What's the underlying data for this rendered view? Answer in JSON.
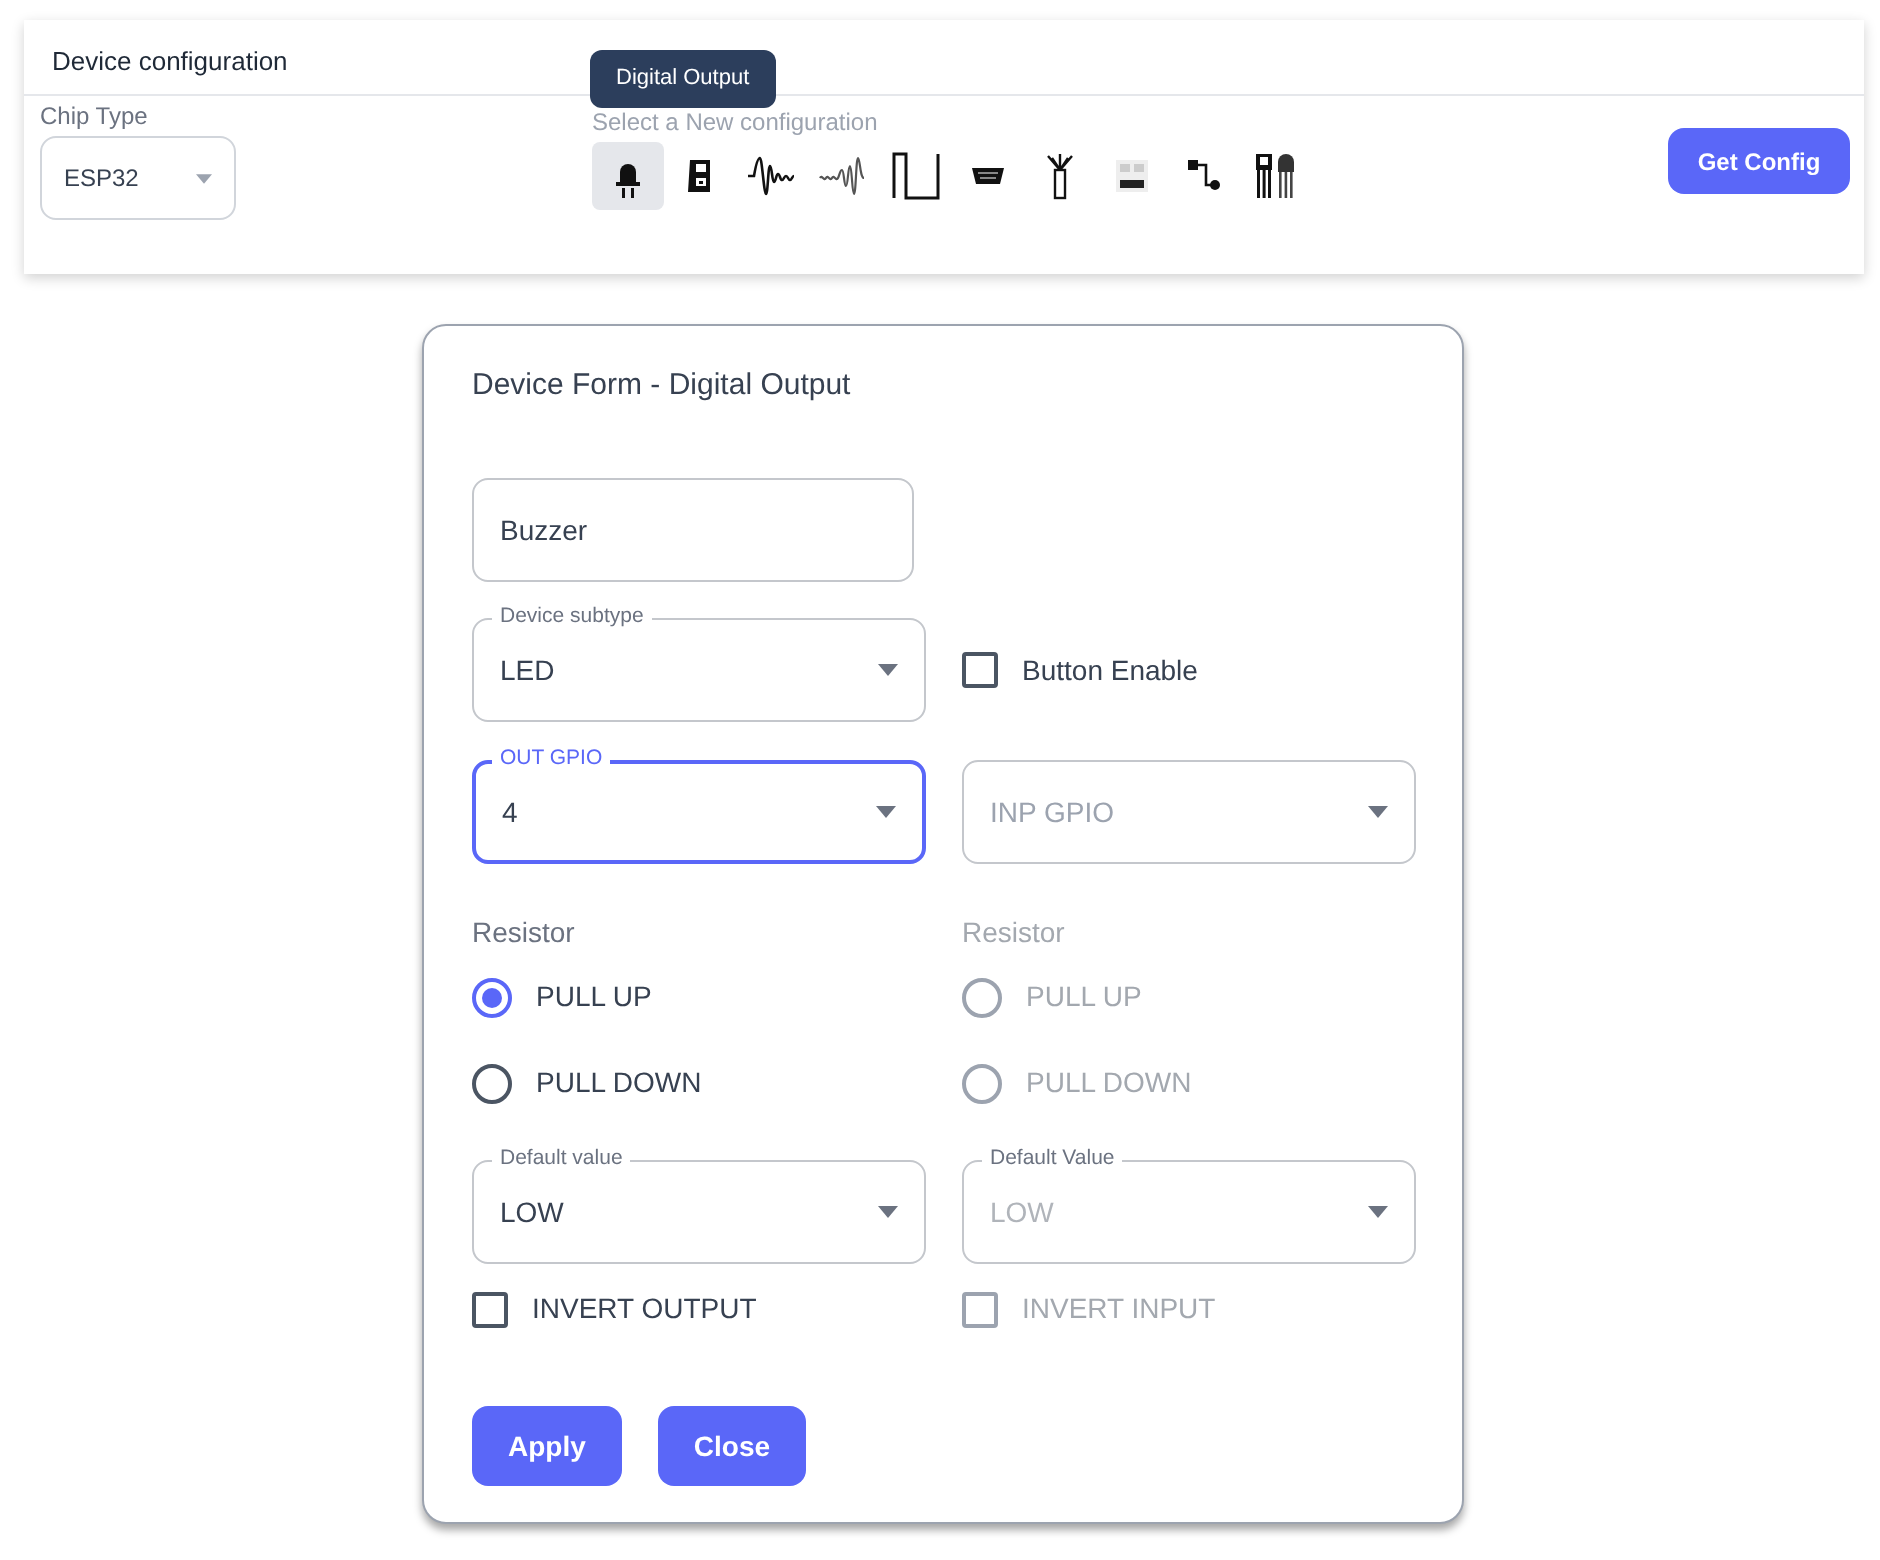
{
  "header": {
    "title": "Device configuration"
  },
  "chip_type": {
    "label": "Chip Type",
    "value": "ESP32"
  },
  "config_picker": {
    "label": "Select a New configuration",
    "tooltip": "Digital Output",
    "options": [
      {
        "kind": "led",
        "selected": true
      },
      {
        "kind": "module",
        "selected": false
      },
      {
        "kind": "wave",
        "selected": false
      },
      {
        "kind": "wave-small",
        "selected": false
      },
      {
        "kind": "pulse",
        "selected": false
      },
      {
        "kind": "connector",
        "selected": false
      },
      {
        "kind": "antenna",
        "selected": false
      },
      {
        "kind": "bus",
        "selected": false
      },
      {
        "kind": "circuit",
        "selected": false
      },
      {
        "kind": "transistor",
        "selected": false
      }
    ]
  },
  "get_config_button": "Get Config",
  "form": {
    "title": "Device Form - Digital Output",
    "name_field": {
      "value": "Buzzer"
    },
    "subtype": {
      "label": "Device subtype",
      "value": "LED"
    },
    "button_enable": {
      "label": "Button Enable",
      "checked": false
    },
    "columns": [
      {
        "disabled": false,
        "gpio": {
          "label": "OUT GPIO",
          "value": "4",
          "focused": true
        },
        "resistor_label": "Resistor",
        "resistor_options": [
          {
            "label": "PULL UP",
            "selected": true
          },
          {
            "label": "PULL DOWN",
            "selected": false
          }
        ],
        "default_value": {
          "label": "Default value",
          "value": "LOW"
        },
        "invert": {
          "label": "INVERT OUTPUT",
          "checked": false
        }
      },
      {
        "disabled": true,
        "gpio": {
          "placeholder": "INP GPIO",
          "focused": false
        },
        "resistor_label": "Resistor",
        "resistor_options": [
          {
            "label": "PULL UP",
            "selected": false
          },
          {
            "label": "PULL DOWN",
            "selected": false
          }
        ],
        "default_value": {
          "label": "Default Value",
          "value": "LOW"
        },
        "invert": {
          "label": "INVERT INPUT",
          "checked": false
        }
      }
    ],
    "buttons": [
      "Apply",
      "Close"
    ]
  }
}
